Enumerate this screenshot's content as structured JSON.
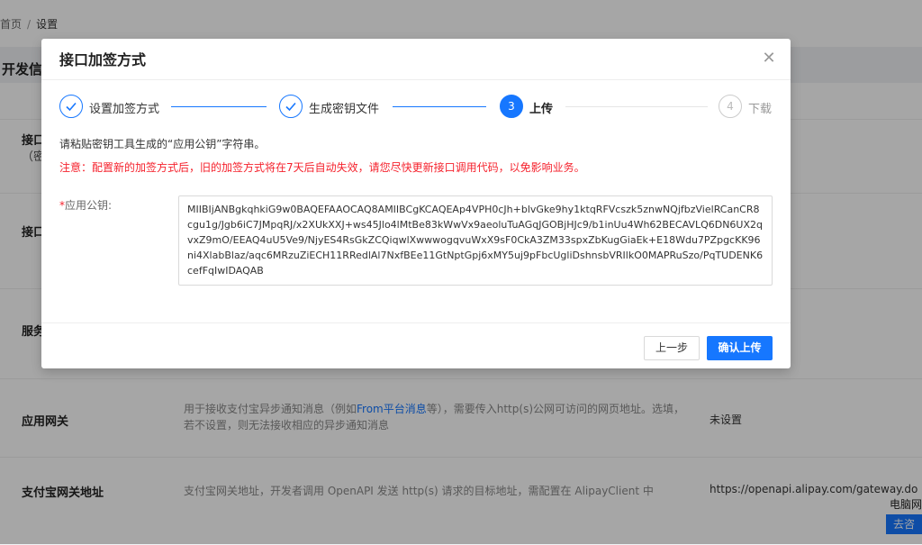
{
  "breadcrumb": {
    "home": "首页",
    "separator": "/",
    "current": "设置"
  },
  "section_title": "开发信",
  "rows": [
    {
      "label": "接口",
      "sub": "（密"
    },
    {
      "label": "接口"
    },
    {
      "label": "服务"
    },
    {
      "label": "应用网关",
      "desc_pre": "用于接收支付宝异步通知消息（例如",
      "desc_link": "From平台消息",
      "desc_post": "等），需要传入http(s)公网可访问的网页地址。选填，若不设置，则无法接收相应的异步通知消息",
      "value": "未设置"
    },
    {
      "label": "支付宝网关地址",
      "desc": "支付宝网关地址，开发者调用 OpenAPI 发送 http(s) 请求的目标地址，需配置在 AlipayClient 中",
      "value": "https://openapi.alipay.com/gateway.do"
    }
  ],
  "float_widget": {
    "line1": "电脑网",
    "line2": "去咨"
  },
  "modal": {
    "title": "接口加签方式",
    "close_icon": "close-icon",
    "steps": [
      {
        "number": "1",
        "label": "设置加签方式",
        "status": "done"
      },
      {
        "number": "2",
        "label": "生成密钥文件",
        "status": "done"
      },
      {
        "number": "3",
        "label": "上传",
        "status": "active"
      },
      {
        "number": "4",
        "label": "下载",
        "status": "wait"
      }
    ],
    "hint": "请粘贴密钥工具生成的“应用公钥”字符串。",
    "warning": "注意：配置新的加签方式后，旧的加签方式将在7天后自动失效，请您尽快更新接口调用代码，以免影响业务。",
    "field": {
      "required_mark": "*",
      "label": "应用公钥:",
      "value": "MIIBIjANBgkqhkiG9w0BAQEFAAOCAQ8AMIIBCgKCAQEAp4VPH0cJh+blvGke9hy1ktqRFVcszk5znwNQjfbzVielRCanCR8cgu1g/Jgb6iC7JMpqRJ/x2XUkXXJ+ws45Jlo4lMtBe83kWwVx9aeoluTuAGqJGOBjHJc9/b1inUu4Wh62BECAVLQ6DN6UX2qvxZ9mO/EEAQ4uU5Ve9/NjyES4RsGkZCQiqwlXwwwogqvuWxX9sF0CkA3ZM33spxZbKugGiaEk+E18Wdu7PZpgcKK96ni4XlabBlaz/aqc6MRzuZiECH11RRedlAl7NxfBEe11GtNptGpj6xMY5uj9pFbcUgliDshnsbVRIlkO0MAPRuSzo/PqTUDENK6cefFqIwIDAQAB"
    },
    "buttons": {
      "prev": "上一步",
      "confirm": "确认上传"
    },
    "colors": {
      "primary": "#1677ff",
      "warning": "#f5222d"
    }
  }
}
